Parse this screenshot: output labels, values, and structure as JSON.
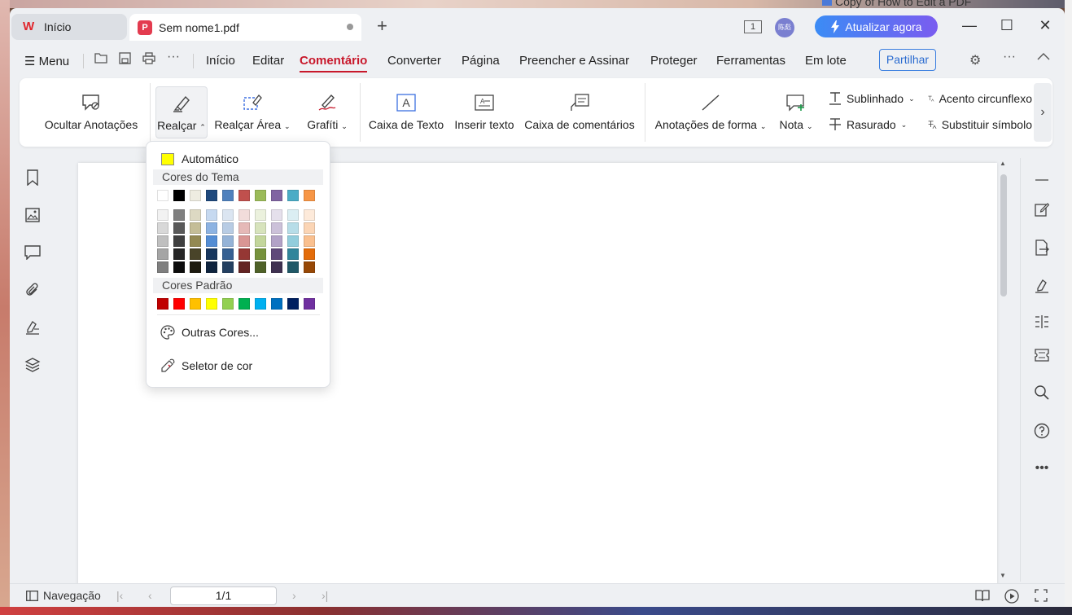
{
  "background_window_title": "Copy of How to Edit a PDF",
  "tabs": [
    {
      "label": "Início"
    },
    {
      "label": "Sem nome1.pdf"
    }
  ],
  "titlebar": {
    "page_indicator": "1",
    "avatar_text": "陈彪",
    "update_label": "Atualizar agora"
  },
  "menu": {
    "menu_label": "Menu",
    "items": [
      "Início",
      "Editar",
      "Comentário",
      "Converter",
      "Página",
      "Preencher e Assinar",
      "Proteger",
      "Ferramentas",
      "Em lote"
    ],
    "active": "Comentário",
    "share_label": "Partilhar"
  },
  "ribbon": {
    "hide_annotations": "Ocultar Anotações",
    "highlight": "Realçar",
    "highlight_area": "Realçar Área",
    "graffiti": "Grafíti",
    "text_box": "Caixa de Texto",
    "insert_text": "Inserir texto",
    "comment_box": "Caixa de comentários",
    "shape_annotations": "Anotações de forma",
    "note": "Nota",
    "underline": "Sublinhado",
    "strikethrough": "Rasurado",
    "caret": "Acento circunflexo",
    "replace_symbol": "Substituir símbolo"
  },
  "color_menu": {
    "automatic_label": "Automático",
    "automatic_color": "#FFFF00",
    "theme_colors_label": "Cores do Tema",
    "theme_colors": [
      "#FFFFFF",
      "#000000",
      "#EEECE1",
      "#1F497D",
      "#4F81BD",
      "#C0504D",
      "#9BBB59",
      "#8064A2",
      "#4BACC6",
      "#F79646"
    ],
    "theme_shades": [
      [
        "#F2F2F2",
        "#7F7F7F",
        "#DDD9C3",
        "#C6D9F0",
        "#DBE5F1",
        "#F2DCDB",
        "#EBF1DD",
        "#E5E0EC",
        "#DBEEF3",
        "#FDEADA"
      ],
      [
        "#D8D8D8",
        "#595959",
        "#C4BD97",
        "#8DB3E2",
        "#B8CCE4",
        "#E5B9B7",
        "#D7E3BC",
        "#CCC1D9",
        "#B7DDE8",
        "#FBD5B5"
      ],
      [
        "#BFBFBF",
        "#3F3F3F",
        "#938953",
        "#548DD4",
        "#95B3D7",
        "#D99694",
        "#C3D69B",
        "#B2A2C7",
        "#92CDDC",
        "#FAC08F"
      ],
      [
        "#A5A5A5",
        "#262626",
        "#494429",
        "#17365D",
        "#366092",
        "#953734",
        "#76923C",
        "#5F497A",
        "#31859B",
        "#E36C09"
      ],
      [
        "#7F7F7F",
        "#0C0C0C",
        "#1D1B10",
        "#0F243E",
        "#244061",
        "#632423",
        "#4F6128",
        "#3F3151",
        "#205867",
        "#974806"
      ]
    ],
    "standard_colors_label": "Cores Padrão",
    "standard_colors": [
      "#C00000",
      "#FF0000",
      "#FFC000",
      "#FFFF00",
      "#92D050",
      "#00B050",
      "#00B0F0",
      "#0070C0",
      "#002060",
      "#7030A0"
    ],
    "more_colors_label": "Outras Cores...",
    "color_picker_label": "Seletor de cor"
  },
  "statusbar": {
    "navigation_label": "Navegação",
    "page_value": "1/1"
  },
  "accent_color": "#C8182B"
}
